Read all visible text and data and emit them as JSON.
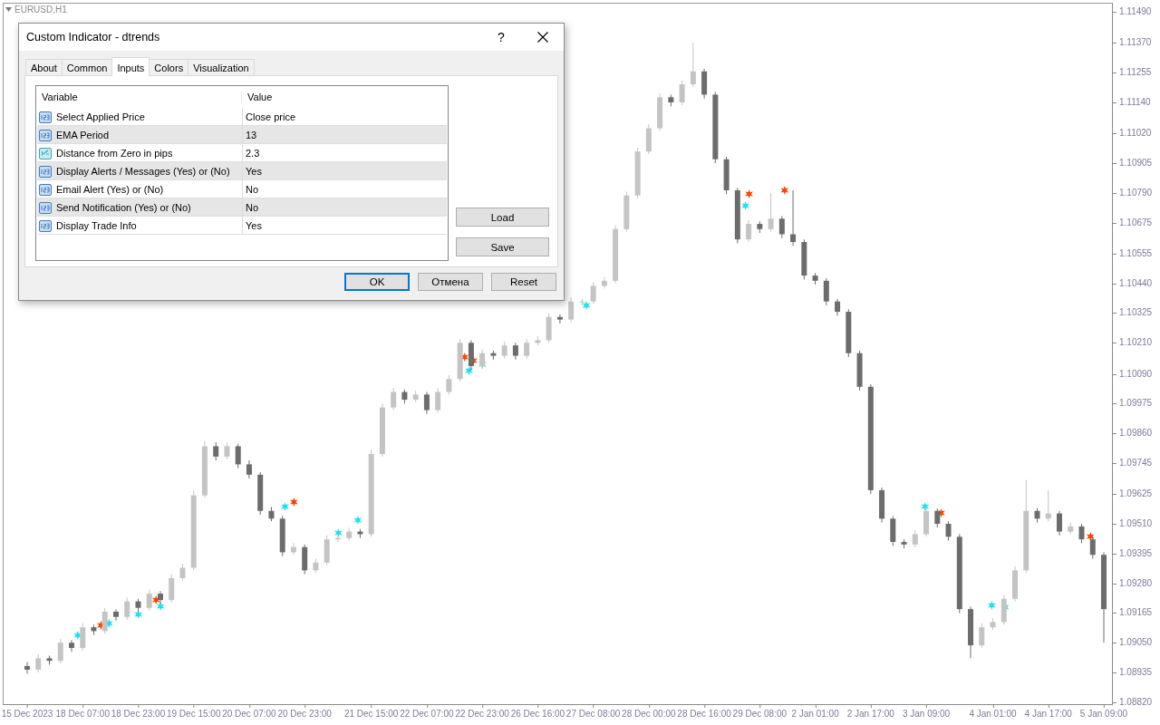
{
  "chart": {
    "symbol": "EURUSD,H1",
    "chart_data": {
      "type": "candlestick",
      "ylim": [
        1.08809,
        1.11522
      ],
      "yticks": [
        {
          "value": 1.1149,
          "label": "1.11490"
        },
        {
          "value": 1.1137,
          "label": "1.11370"
        },
        {
          "value": 1.11255,
          "label": "1.11255"
        },
        {
          "value": 1.1114,
          "label": "1.11140"
        },
        {
          "value": 1.1102,
          "label": "1.11020"
        },
        {
          "value": 1.10905,
          "label": "1.10905"
        },
        {
          "value": 1.1079,
          "label": "1.10790"
        },
        {
          "value": 1.10675,
          "label": "1.10675"
        },
        {
          "value": 1.10555,
          "label": "1.10555"
        },
        {
          "value": 1.1044,
          "label": "1.10440"
        },
        {
          "value": 1.10325,
          "label": "1.10325"
        },
        {
          "value": 1.1021,
          "label": "1.10210"
        },
        {
          "value": 1.1009,
          "label": "1.10090"
        },
        {
          "value": 1.09975,
          "label": "1.09975"
        },
        {
          "value": 1.0986,
          "label": "1.09860"
        },
        {
          "value": 1.09745,
          "label": "1.09745"
        },
        {
          "value": 1.09625,
          "label": "1.09625"
        },
        {
          "value": 1.0951,
          "label": "1.09510"
        },
        {
          "value": 1.09395,
          "label": "1.09395"
        },
        {
          "value": 1.0928,
          "label": "1.09280"
        },
        {
          "value": 1.09165,
          "label": "1.09165"
        },
        {
          "value": 1.0905,
          "label": "1.09050"
        },
        {
          "value": 1.08935,
          "label": "1.08935"
        },
        {
          "value": 1.0882,
          "label": "1.08820"
        }
      ],
      "categories": [
        "15 Dec 2023",
        null,
        null,
        null,
        null,
        "18 Dec 07:00",
        null,
        null,
        null,
        null,
        "18 Dec 23:00",
        null,
        null,
        null,
        null,
        "19 Dec 15:00",
        null,
        null,
        null,
        null,
        "20 Dec 07:00",
        null,
        null,
        null,
        null,
        "20 Dec 23:00",
        null,
        null,
        null,
        null,
        null,
        "21 Dec 15:00",
        null,
        null,
        null,
        null,
        "22 Dec 07:00",
        null,
        null,
        null,
        null,
        "22 Dec 23:00",
        null,
        null,
        null,
        null,
        "26 Dec 16:00",
        null,
        null,
        null,
        null,
        "27 Dec 08:00",
        null,
        null,
        null,
        null,
        "28 Dec 00:00",
        null,
        null,
        null,
        null,
        "28 Dec 16:00",
        null,
        null,
        null,
        null,
        "29 Dec 08:00",
        null,
        null,
        null,
        null,
        "2 Jan 01:00",
        null,
        null,
        null,
        null,
        "2 Jan 17:00",
        null,
        null,
        null,
        null,
        "3 Jan 09:00",
        null,
        null,
        null,
        null,
        null,
        "4 Jan 01:00",
        null,
        null,
        null,
        null,
        "4 Jan 17:00",
        null,
        null,
        null,
        null,
        "5 Jan 09:00"
      ],
      "ohlc": [
        [
          1.0896,
          1.08975,
          1.0893,
          1.08946
        ],
        [
          1.08946,
          1.09005,
          1.08935,
          1.0899
        ],
        [
          1.0899,
          1.09,
          1.08965,
          1.0898
        ],
        [
          1.0898,
          1.09065,
          1.0897,
          1.0905
        ],
        [
          1.0905,
          1.0906,
          1.09015,
          1.0903
        ],
        [
          1.0903,
          1.09125,
          1.0902,
          1.0911
        ],
        [
          1.0911,
          1.0912,
          1.0908,
          1.09095
        ],
        [
          1.09095,
          1.09185,
          1.09085,
          1.0917
        ],
        [
          1.0917,
          1.0918,
          1.09135,
          1.0915
        ],
        [
          1.0915,
          1.09225,
          1.0914,
          1.0921
        ],
        [
          1.0921,
          1.0922,
          1.0917,
          1.09185
        ],
        [
          1.09185,
          1.09255,
          1.09175,
          1.0924
        ],
        [
          1.0924,
          1.0925,
          1.092,
          1.09215
        ],
        [
          1.09215,
          1.09315,
          1.09205,
          1.093
        ],
        [
          1.093,
          1.09355,
          1.0929,
          1.0934
        ],
        [
          1.0934,
          1.0964,
          1.0933,
          1.0962
        ],
        [
          1.0962,
          1.0983,
          1.0961,
          1.0981
        ],
        [
          1.0981,
          1.09825,
          1.09755,
          1.0977
        ],
        [
          1.0977,
          1.09825,
          1.0976,
          1.0981
        ],
        [
          1.0981,
          1.0982,
          1.09725,
          1.0974
        ],
        [
          1.0974,
          1.09755,
          1.09685,
          1.097
        ],
        [
          1.097,
          1.0971,
          1.09545,
          1.0956
        ],
        [
          1.0956,
          1.09575,
          1.0952,
          1.0953
        ],
        [
          1.0953,
          1.0954,
          1.09385,
          1.094
        ],
        [
          1.094,
          1.09435,
          1.0939,
          1.0942
        ],
        [
          1.0942,
          1.0943,
          1.09315,
          1.0933
        ],
        [
          1.0933,
          1.09375,
          1.0932,
          1.0936
        ],
        [
          1.0936,
          1.09465,
          1.0935,
          1.0945
        ],
        [
          1.0945,
          1.0947,
          1.0944,
          1.09455
        ],
        [
          1.09455,
          1.09495,
          1.09445,
          1.0948
        ],
        [
          1.0948,
          1.0949,
          1.09455,
          1.0947
        ],
        [
          1.0947,
          1.09795,
          1.0946,
          1.0978
        ],
        [
          1.0978,
          1.09975,
          1.0977,
          1.0996
        ],
        [
          1.0996,
          1.10035,
          1.0995,
          1.1002
        ],
        [
          1.1002,
          1.1003,
          1.09975,
          1.0999
        ],
        [
          1.0999,
          1.10025,
          1.0998,
          1.1001
        ],
        [
          1.1001,
          1.1002,
          1.09935,
          1.0995
        ],
        [
          1.0995,
          1.10035,
          1.0994,
          1.1002
        ],
        [
          1.1002,
          1.10085,
          1.1001,
          1.1007
        ],
        [
          1.1007,
          1.10225,
          1.1006,
          1.1021
        ],
        [
          1.1021,
          1.1022,
          1.10105,
          1.1012
        ],
        [
          1.1012,
          1.10185,
          1.1011,
          1.1017
        ],
        [
          1.1017,
          1.1018,
          1.10145,
          1.1016
        ],
        [
          1.1016,
          1.10215,
          1.1015,
          1.102
        ],
        [
          1.102,
          1.1021,
          1.10145,
          1.1016
        ],
        [
          1.1016,
          1.10225,
          1.1015,
          1.1021
        ],
        [
          1.1021,
          1.10235,
          1.102,
          1.1022
        ],
        [
          1.1022,
          1.10325,
          1.1021,
          1.1031
        ],
        [
          1.1031,
          1.1032,
          1.10285,
          1.103
        ],
        [
          1.103,
          1.10385,
          1.1029,
          1.1037
        ],
        [
          1.1037,
          1.1038,
          1.10355,
          1.1037
        ],
        [
          1.1037,
          1.10445,
          1.1036,
          1.1043
        ],
        [
          1.1043,
          1.10465,
          1.1042,
          1.1045
        ],
        [
          1.1045,
          1.10665,
          1.1044,
          1.1065
        ],
        [
          1.1065,
          1.10795,
          1.1064,
          1.1078
        ],
        [
          1.1078,
          1.10965,
          1.1077,
          1.1095
        ],
        [
          1.1095,
          1.11055,
          1.1094,
          1.1104
        ],
        [
          1.1104,
          1.11175,
          1.1103,
          1.1116
        ],
        [
          1.1116,
          1.1117,
          1.11125,
          1.1114
        ],
        [
          1.1114,
          1.11225,
          1.1113,
          1.1121
        ],
        [
          1.1121,
          1.1137,
          1.112,
          1.1126
        ],
        [
          1.1126,
          1.1127,
          1.11155,
          1.1117
        ],
        [
          1.1117,
          1.1118,
          1.10905,
          1.1092
        ],
        [
          1.1092,
          1.1093,
          1.10785,
          1.108
        ],
        [
          1.108,
          1.1081,
          1.10595,
          1.1061
        ],
        [
          1.1061,
          1.10685,
          1.106,
          1.1067
        ],
        [
          1.1067,
          1.1068,
          1.10635,
          1.1065
        ],
        [
          1.1065,
          1.1079,
          1.1064,
          1.1069
        ],
        [
          1.1069,
          1.107,
          1.10615,
          1.1063
        ],
        [
          1.1063,
          1.108,
          1.10585,
          1.106
        ],
        [
          1.106,
          1.1061,
          1.10455,
          1.1047
        ],
        [
          1.1047,
          1.1048,
          1.10435,
          1.1045
        ],
        [
          1.1045,
          1.1046,
          1.10355,
          1.1037
        ],
        [
          1.1037,
          1.1038,
          1.10315,
          1.1033
        ],
        [
          1.1033,
          1.1034,
          1.10155,
          1.1017
        ],
        [
          1.1017,
          1.1018,
          1.10025,
          1.1004
        ],
        [
          1.1004,
          1.1005,
          1.09625,
          1.0964
        ],
        [
          1.0964,
          1.0965,
          1.09515,
          1.0953
        ],
        [
          1.0953,
          1.0954,
          1.09425,
          1.0944
        ],
        [
          1.0944,
          1.0945,
          1.09415,
          1.0943
        ],
        [
          1.0943,
          1.09485,
          1.0942,
          1.0947
        ],
        [
          1.0947,
          1.09575,
          1.0946,
          1.0956
        ],
        [
          1.0956,
          1.0957,
          1.09495,
          1.0951
        ],
        [
          1.0951,
          1.0952,
          1.09445,
          1.0946
        ],
        [
          1.0946,
          1.0947,
          1.09165,
          1.0918
        ],
        [
          1.0918,
          1.0919,
          1.0899,
          1.0904
        ],
        [
          1.0904,
          1.09125,
          1.0903,
          1.0911
        ],
        [
          1.0911,
          1.09145,
          1.091,
          1.0913
        ],
        [
          1.0913,
          1.09235,
          1.0912,
          1.0922
        ],
        [
          1.0922,
          1.09345,
          1.0921,
          1.0933
        ],
        [
          1.0933,
          1.0968,
          1.0932,
          1.0956
        ],
        [
          1.0956,
          1.0957,
          1.09515,
          1.0953
        ],
        [
          1.0953,
          1.0964,
          1.0952,
          1.0955
        ],
        [
          1.0955,
          1.0956,
          1.09465,
          1.0948
        ],
        [
          1.0948,
          1.09515,
          1.0947,
          1.095
        ],
        [
          1.095,
          1.0951,
          1.09435,
          1.0945
        ],
        [
          1.0945,
          1.0946,
          1.09375,
          1.0939
        ],
        [
          1.0939,
          1.094,
          1.0905,
          1.0918
        ]
      ]
    }
  },
  "dialog": {
    "title": "Custom Indicator - dtrends",
    "help": "?",
    "tabs": [
      {
        "label": "About",
        "selected": false
      },
      {
        "label": "Common",
        "selected": false
      },
      {
        "label": "Inputs",
        "selected": true
      },
      {
        "label": "Colors",
        "selected": false
      },
      {
        "label": "Visualization",
        "selected": false
      }
    ],
    "table": {
      "columns": [
        "Variable",
        "Value"
      ],
      "rows": [
        {
          "kind": "integer",
          "variable": "Select Applied Price",
          "value": "Close price"
        },
        {
          "kind": "integer",
          "variable": "EMA Period",
          "value": "13"
        },
        {
          "kind": "double",
          "variable": "Distance from Zero in pips",
          "value": "2.3"
        },
        {
          "kind": "integer",
          "variable": "Display Alerts / Messages (Yes) or (No)",
          "value": "Yes"
        },
        {
          "kind": "integer",
          "variable": "Email Alert (Yes) or (No)",
          "value": "No"
        },
        {
          "kind": "integer",
          "variable": "Send Notification (Yes) or (No)",
          "value": "No"
        },
        {
          "kind": "integer",
          "variable": "Display Trade Info",
          "value": "Yes"
        }
      ]
    },
    "side_buttons": [
      "Load",
      "Save"
    ],
    "buttons": [
      {
        "label": "OK",
        "default": true
      },
      {
        "label": "Отмена",
        "default": false
      },
      {
        "label": "Reset",
        "default": false
      }
    ]
  }
}
